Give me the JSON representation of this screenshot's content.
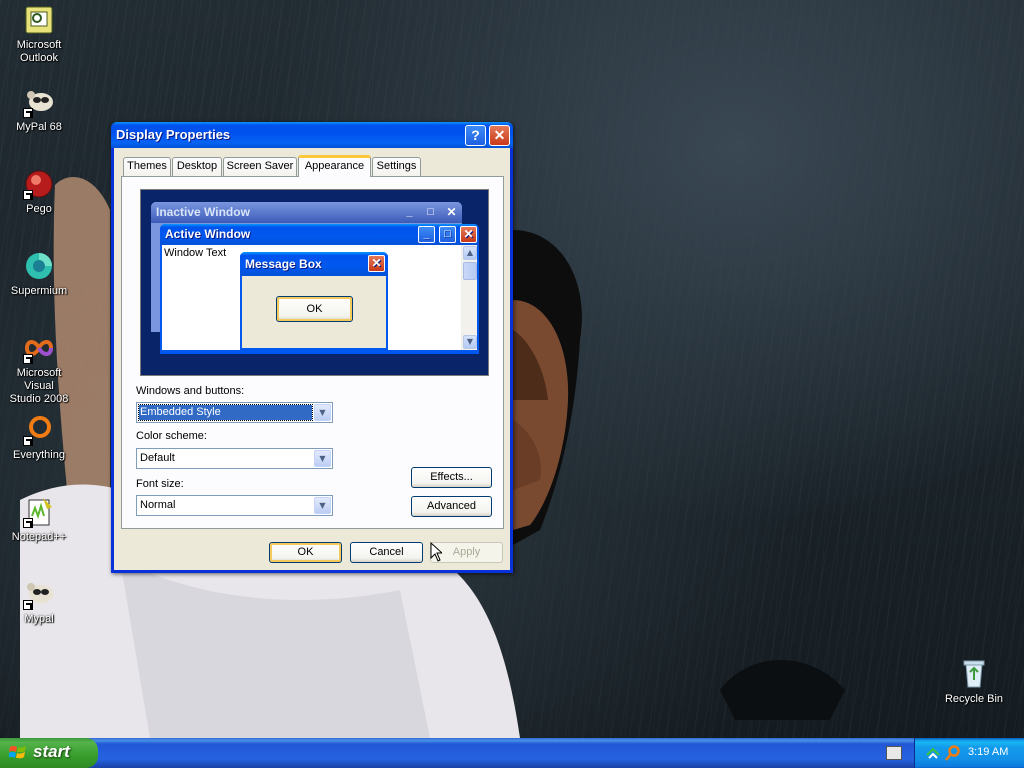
{
  "desktop": {
    "icons": [
      {
        "label": "Microsoft\nOutlook",
        "icon": "outlook-icon"
      },
      {
        "label": "MyPal 68",
        "icon": "mypal-icon"
      },
      {
        "label": "Pego",
        "icon": "pego-icon"
      },
      {
        "label": "Supermium",
        "icon": "supermium-icon"
      },
      {
        "label": "Microsoft Visual\nStudio 2008",
        "icon": "visual-studio-icon"
      },
      {
        "label": "Everything",
        "icon": "everything-icon"
      },
      {
        "label": "Notepad++",
        "icon": "notepad-plus-plus-icon"
      },
      {
        "label": "Mypal",
        "icon": "mypal-icon"
      },
      {
        "label": "Recycle Bin",
        "icon": "recycle-bin-icon"
      }
    ]
  },
  "window": {
    "title": "Display Properties",
    "help_glyph": "?",
    "close_glyph": "✕",
    "tabs": [
      {
        "label": "Themes"
      },
      {
        "label": "Desktop"
      },
      {
        "label": "Screen Saver"
      },
      {
        "label": "Appearance"
      },
      {
        "label": "Settings"
      }
    ],
    "active_tab": "Appearance",
    "preview": {
      "inactive_title": "Inactive Window",
      "active_title": "Active Window",
      "window_text": "Window Text",
      "msgbox_title": "Message Box",
      "msgbox_ok": "OK"
    },
    "windows_buttons_label": "Windows and buttons:",
    "windows_buttons_value": "Embedded Style",
    "color_scheme_label": "Color scheme:",
    "color_scheme_value": "Default",
    "font_size_label": "Font size:",
    "font_size_value": "Normal",
    "effects_label": "Effects...",
    "advanced_label": "Advanced",
    "ok_label": "OK",
    "cancel_label": "Cancel",
    "apply_label": "Apply"
  },
  "taskbar": {
    "start_label": "start",
    "clock": "3:19 AM"
  },
  "colors": {
    "title_blue": "#0053ee",
    "taskbar_blue": "#245edb",
    "start_green": "#379d2c",
    "tray_blue": "#1290e8",
    "dialog_face": "#ece9d8"
  }
}
